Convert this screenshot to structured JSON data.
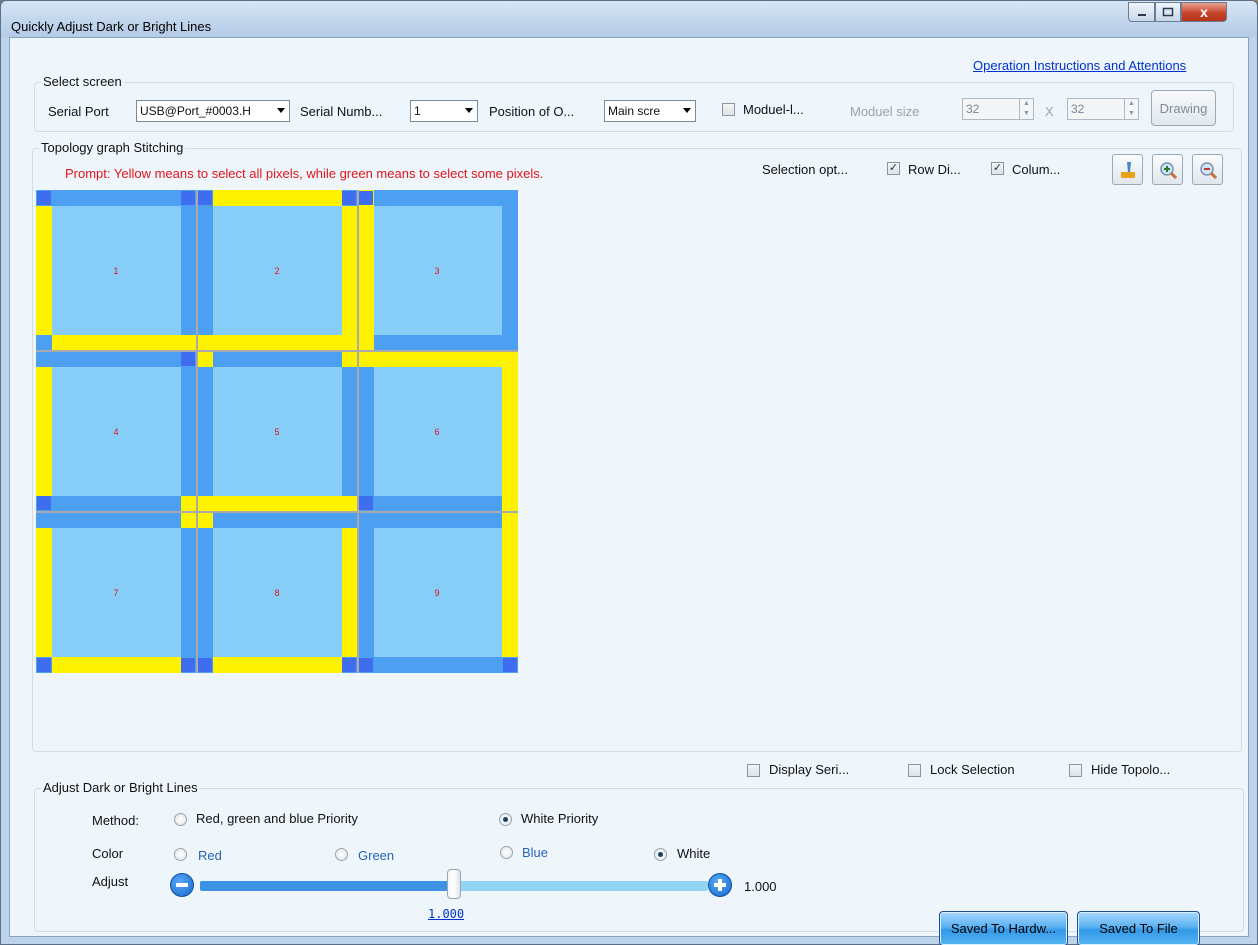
{
  "window": {
    "title": "Quickly Adjust Dark or Bright Lines",
    "close_glyph": "x"
  },
  "link": "Operation Instructions and Attentions",
  "select_screen": {
    "group_title": "Select screen",
    "serial_port_label": "Serial Port",
    "serial_port_value": "USB@Port_#0003.H",
    "serial_number_label": "Serial Numb...",
    "serial_number_value": "1",
    "position_label": "Position of O...",
    "position_value": "Main scre",
    "moduel_l_label": "Moduel-l...",
    "moduel_size_label": "Moduel size",
    "module_width": "32",
    "x_label": "X",
    "module_height": "32",
    "drawing_label": "Drawing"
  },
  "topology": {
    "group_title": "Topology graph Stitching",
    "prompt": "Prompt: Yellow means to select all pixels, while green means to select some pixels.",
    "selection_label": "Selection opt...",
    "row_label": "Row Di...",
    "column_label": "Colum...",
    "cells": [
      "1",
      "2",
      "3",
      "4",
      "5",
      "6",
      "7",
      "8",
      "9"
    ],
    "colors": {
      "panel": "#86cdf7",
      "edge": "#4d9ff2",
      "selected_full": "#fff200",
      "corner": "#3f6df0",
      "number": "#e4141b"
    }
  },
  "options": {
    "display_serial": "Display Seri...",
    "lock_selection": "Lock Selection",
    "hide_topology": "Hide Topolo..."
  },
  "adjust": {
    "group_title": "Adjust Dark or Bright Lines",
    "method_label": "Method:",
    "method_rgb": "Red, green and blue Priority",
    "method_white": "White Priority",
    "color_label": "Color",
    "red": "Red",
    "green": "Green",
    "blue": "Blue",
    "white": "White",
    "adjust_label": "Adjust",
    "value": "1.000",
    "value_link": "1.000",
    "slider_fraction": 0.5,
    "save_hardware": "Saved To Hardw...",
    "save_file": "Saved To File"
  }
}
